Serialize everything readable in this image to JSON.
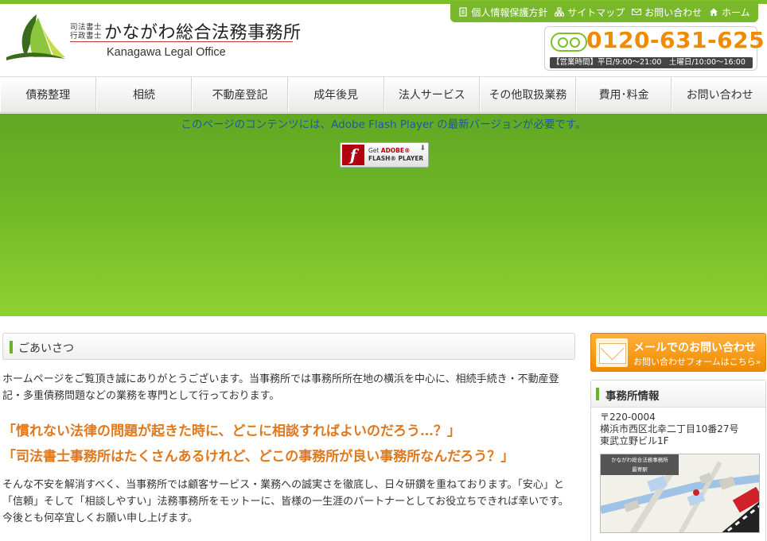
{
  "colors": {
    "brand_green": "#7cbf26",
    "accent_orange": "#f08a00",
    "link_blue": "#1c5b9a"
  },
  "utility_nav": [
    {
      "icon": "document-icon",
      "label": "個人情報保護方針"
    },
    {
      "icon": "sitemap-icon",
      "label": "サイトマップ"
    },
    {
      "icon": "mail-icon",
      "label": "お問い合わせ"
    },
    {
      "icon": "home-icon",
      "label": "ホーム"
    }
  ],
  "logo": {
    "sub1": "司法書士",
    "sub2": "行政書士",
    "name": "かながわ総合法務事務所",
    "en": "Kanagawa Legal Office"
  },
  "phone": {
    "icon": "freedial-icon",
    "number": "0120-631-625",
    "hours": "【営業時間】平日/9:00～21:00　土曜日/10:00～16:00"
  },
  "nav": [
    "債務整理",
    "相続",
    "不動産登記",
    "成年後見",
    "法人サービス",
    "その他取扱業務",
    "費用･料金",
    "お問い合わせ"
  ],
  "hero": {
    "flash_message": "このページのコンテンツには、Adobe Flash Player の最新バージョンが必要です。",
    "button": {
      "icon": "flash-icon",
      "line1_prefix": "Get ",
      "line1_brand": "ADOBE®",
      "line2": "FLASH® PLAYER"
    }
  },
  "greeting": {
    "title": "ごあいさつ",
    "para1": "ホームページをご覧頂き誠にありがとうございます。当事務所では事務所所在地の横浜を中心に、相続手続き・不動産登記・多重債務問題などの業務を専門として行っております。",
    "quote1": "「慣れない法律の問題が起きた時に、どこに相談すればよいのだろう…？」",
    "quote2": "「司法書士事務所はたくさんあるけれど、どこの事務所が良い事務所なんだろう？」",
    "para2": "そんな不安を解消すべく、当事務所では顧客サービス・業務への誠実さを徹底し、日々研鑽を重ねております。「安心」と「信頼」そして「相談しやすい」法務事務所をモットーに、皆様の一生涯のパートナーとしてお役立ちできれば幸いです。今後とも何卒宜しくお願い申し上げます。"
  },
  "sidebar": {
    "mail_banner": {
      "line1": "メールでのお問い合わせ",
      "line2": "お問い合わせフォームはこちら»"
    },
    "office": {
      "title": "事務所情報",
      "postal": "〒220-0004",
      "addr1": "横浜市西区北幸二丁目10番27号",
      "addr2": "東武立野ビル1F",
      "map_label1": "かながわ総合法務事務所",
      "map_label2": "最寄駅"
    }
  }
}
